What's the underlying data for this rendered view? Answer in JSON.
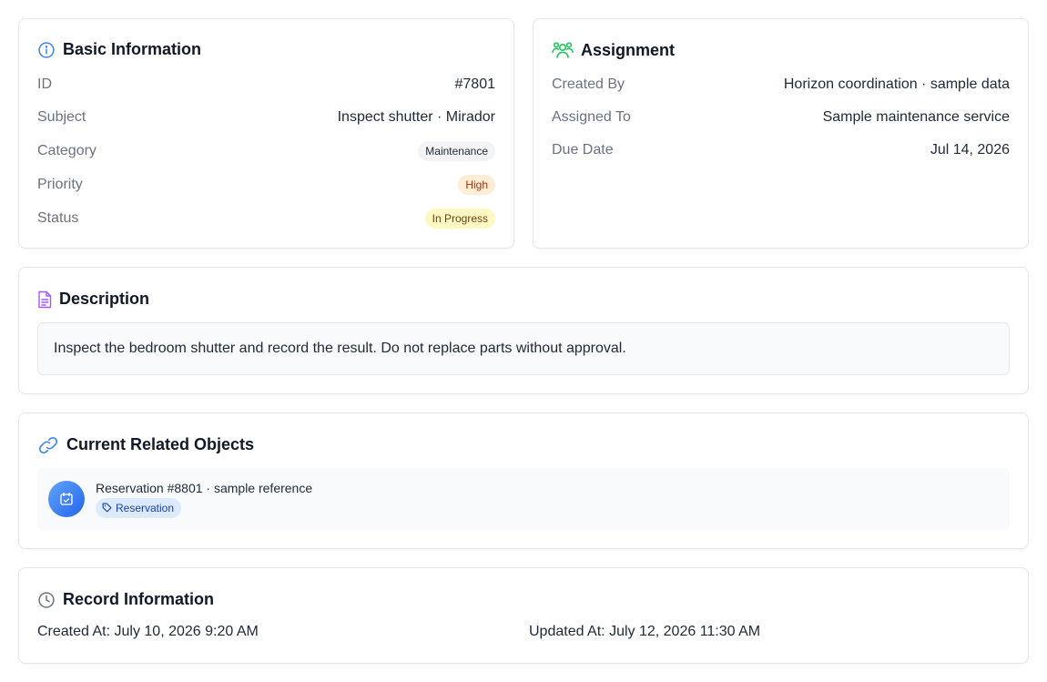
{
  "basic": {
    "title": "Basic Information",
    "icon": "info-icon",
    "rows": [
      {
        "label": "ID",
        "value": "#7801"
      },
      {
        "label": "Subject",
        "value": "Inspect shutter · Mirador"
      },
      {
        "label": "Category",
        "value": "Maintenance"
      },
      {
        "label": "Priority",
        "value": "High"
      },
      {
        "label": "Status",
        "value": "In Progress"
      }
    ]
  },
  "assignment": {
    "title": "Assignment",
    "icon": "users-icon",
    "rows": [
      {
        "label": "Created By",
        "value": "Horizon coordination · sample data"
      },
      {
        "label": "Assigned To",
        "value": "Sample maintenance service"
      },
      {
        "label": "Due Date",
        "value": "Jul 14, 2026"
      }
    ]
  },
  "description": {
    "title": "Description",
    "icon": "file-text-icon",
    "text": "Inspect the bedroom shutter and record the result. Do not replace parts without approval."
  },
  "related": {
    "title": "Current Related Objects",
    "icon": "link-icon",
    "items": [
      {
        "name": "Reservation #8801 · sample reference",
        "tag": "Reservation",
        "icon": "calendar-check-icon",
        "tag_icon": "tag-icon"
      }
    ]
  },
  "record": {
    "title": "Record Information",
    "icon": "clock-icon",
    "created": "Created At: July 10, 2026 9:20 AM",
    "updated": "Updated At: July 12, 2026 11:30 AM"
  },
  "colors": {
    "info_icon": "#3b82f6",
    "users_icon": "#22c55e",
    "file_icon": "#a855f7",
    "link_icon": "#3b82f6",
    "clock_icon": "#6b7280",
    "priority_high_bg": "#ffedd5",
    "status_progress_bg": "#fef9c3"
  }
}
